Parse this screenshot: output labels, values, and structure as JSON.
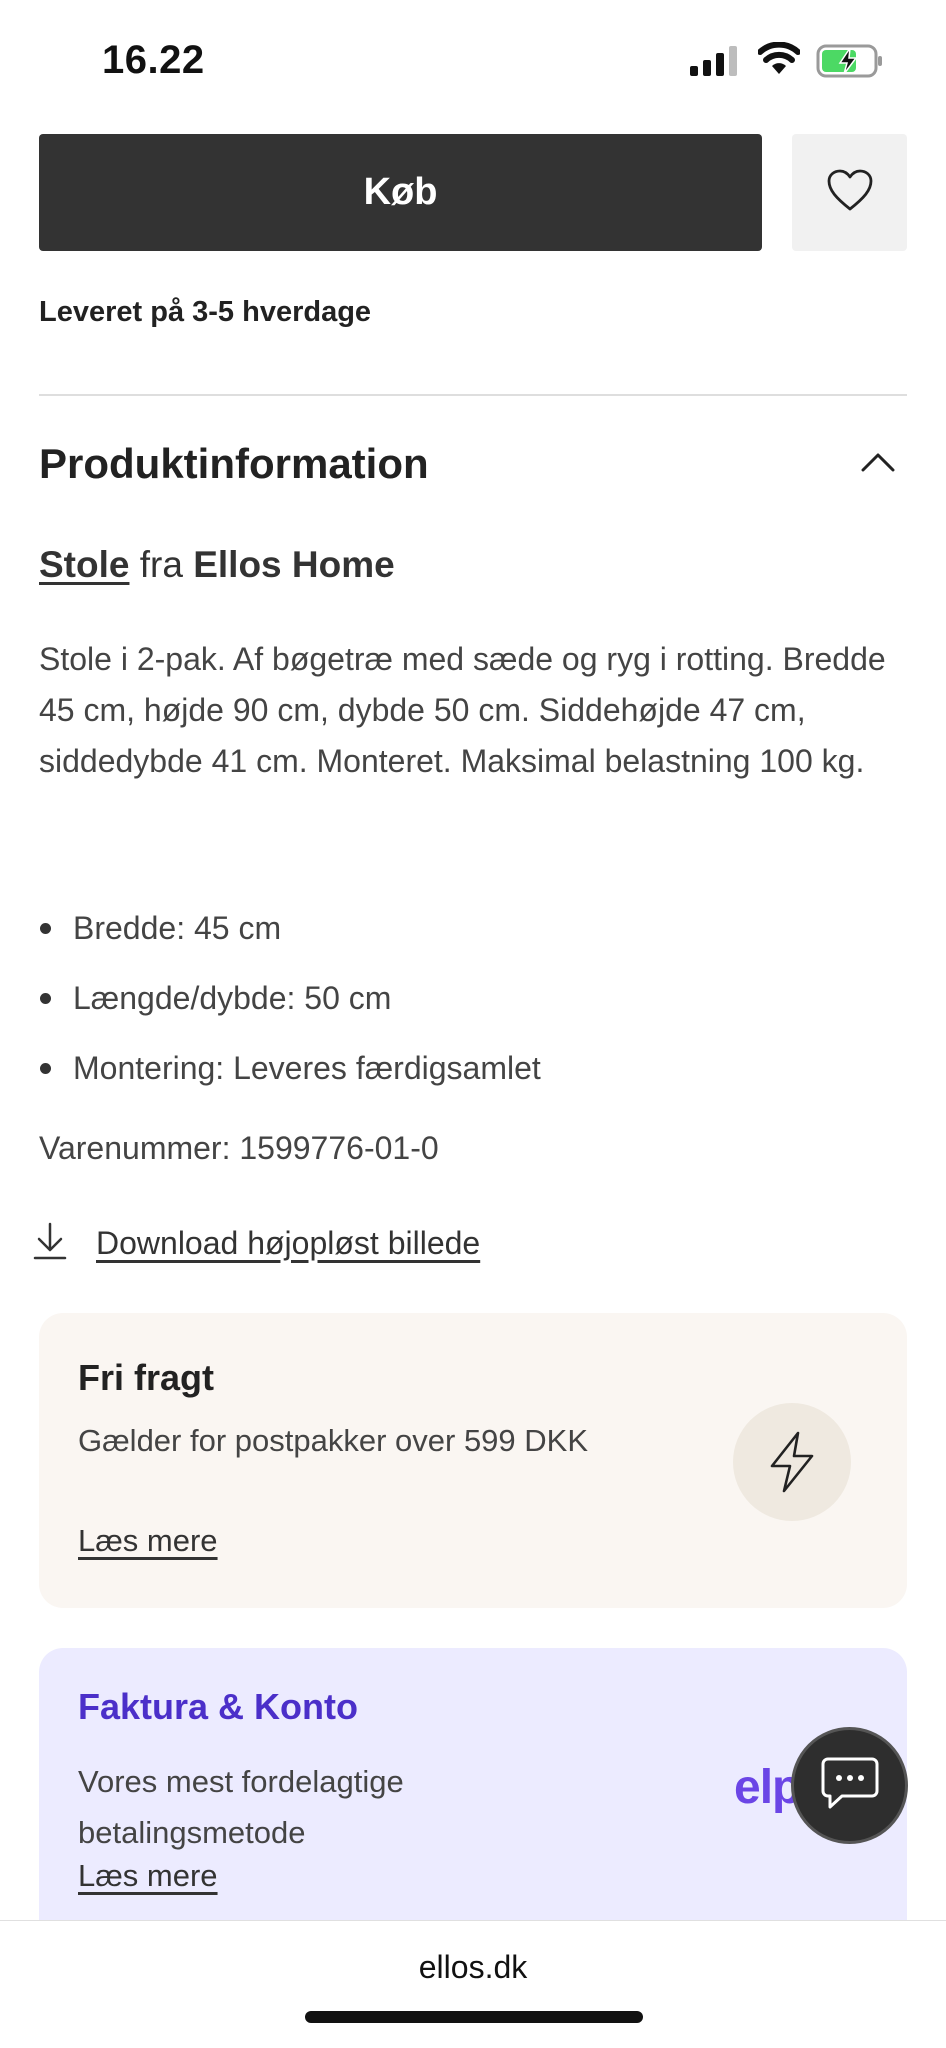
{
  "status_bar": {
    "time": "16.22",
    "icons": [
      "signal-icon",
      "wifi-icon",
      "battery-charging-icon"
    ]
  },
  "purchase": {
    "buy_label": "Køb",
    "favorite_icon": "heart-icon",
    "delivery_text": "Leveret på 3-5 hverdage"
  },
  "product_info": {
    "section_title": "Produktinformation",
    "collapse_icon": "chevron-up-icon",
    "category_link": "Stole",
    "from_word": "fra",
    "brand": "Ellos Home",
    "description": "Stole i 2-pak. Af bøgetræ med sæde og ryg i rotting. Bredde 45 cm, højde 90 cm, dybde 50 cm. Siddehøjde 47 cm, siddedybde 41 cm. Monteret. Maksimal belastning 100 kg.",
    "specs": [
      "Bredde: 45 cm",
      "Længde/dybde: 50 cm",
      "Montering: Leveres færdigsamlet"
    ],
    "sku": "Varenummer: 1599776-01-0",
    "download_label": "Download højopløst billede"
  },
  "free_shipping_card": {
    "title": "Fri fragt",
    "text": "Gælder for postpakker over 599 DKK",
    "link": "Læs mere",
    "icon": "lightning-icon",
    "bg_color": "#faf6f2"
  },
  "invoice_card": {
    "title": "Faktura & Konto",
    "text": "Vores mest fordelagtige betalingsmetode",
    "link": "Læs mere",
    "logo_text": "elp",
    "accent_color": "#4b2fc9",
    "bg_color": "#ecebff"
  },
  "chat": {
    "icon": "chat-bubble-icon"
  },
  "browser": {
    "url": "ellos.dk"
  }
}
